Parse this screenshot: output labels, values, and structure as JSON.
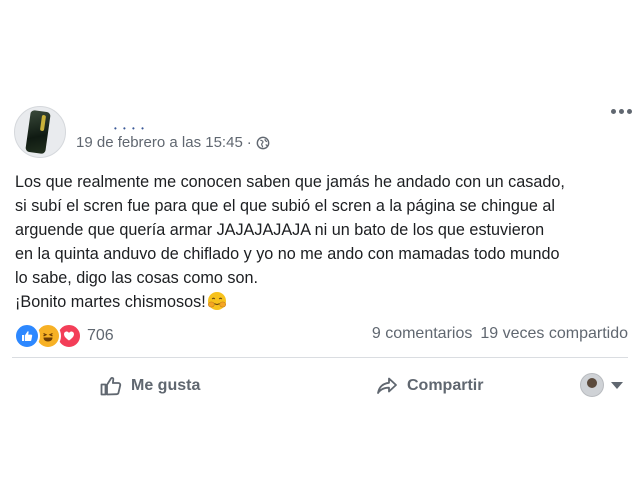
{
  "post": {
    "author_name": "• • • •",
    "timestamp": "19 de febrero a las 15:45",
    "meta_separator": "·",
    "privacy_icon": "globe-icon",
    "menu_icon": "more-options-icon",
    "body_lines": [
      "Los que realmente me conocen saben que jamás he andado con un casado,",
      "si subí el scren fue para que el que subió el scren a la página se chingue al",
      "arguende que quería armar JAJAJAJAJA ni un bato de los que estuvieron",
      "en la quinta anduvo de chiflado y yo no me ando con mamadas todo mundo",
      "lo sabe, digo las cosas como son.",
      "¡Bonito martes chismosos!"
    ],
    "closing_emoji": "smiling-face-with-smiling-eyes-and-hand-covering-mouth"
  },
  "reactions": {
    "icons": [
      "like-reaction-icon",
      "haha-reaction-icon",
      "love-reaction-icon"
    ],
    "count": "706",
    "colors": {
      "like": "#2d88ff",
      "haha": "#f7b125",
      "love": "#f33e58"
    }
  },
  "stats": {
    "comments": "9 comentarios",
    "shares": "19 veces compartido"
  },
  "actions": {
    "like_label": "Me gusta",
    "share_label": "Compartir"
  }
}
